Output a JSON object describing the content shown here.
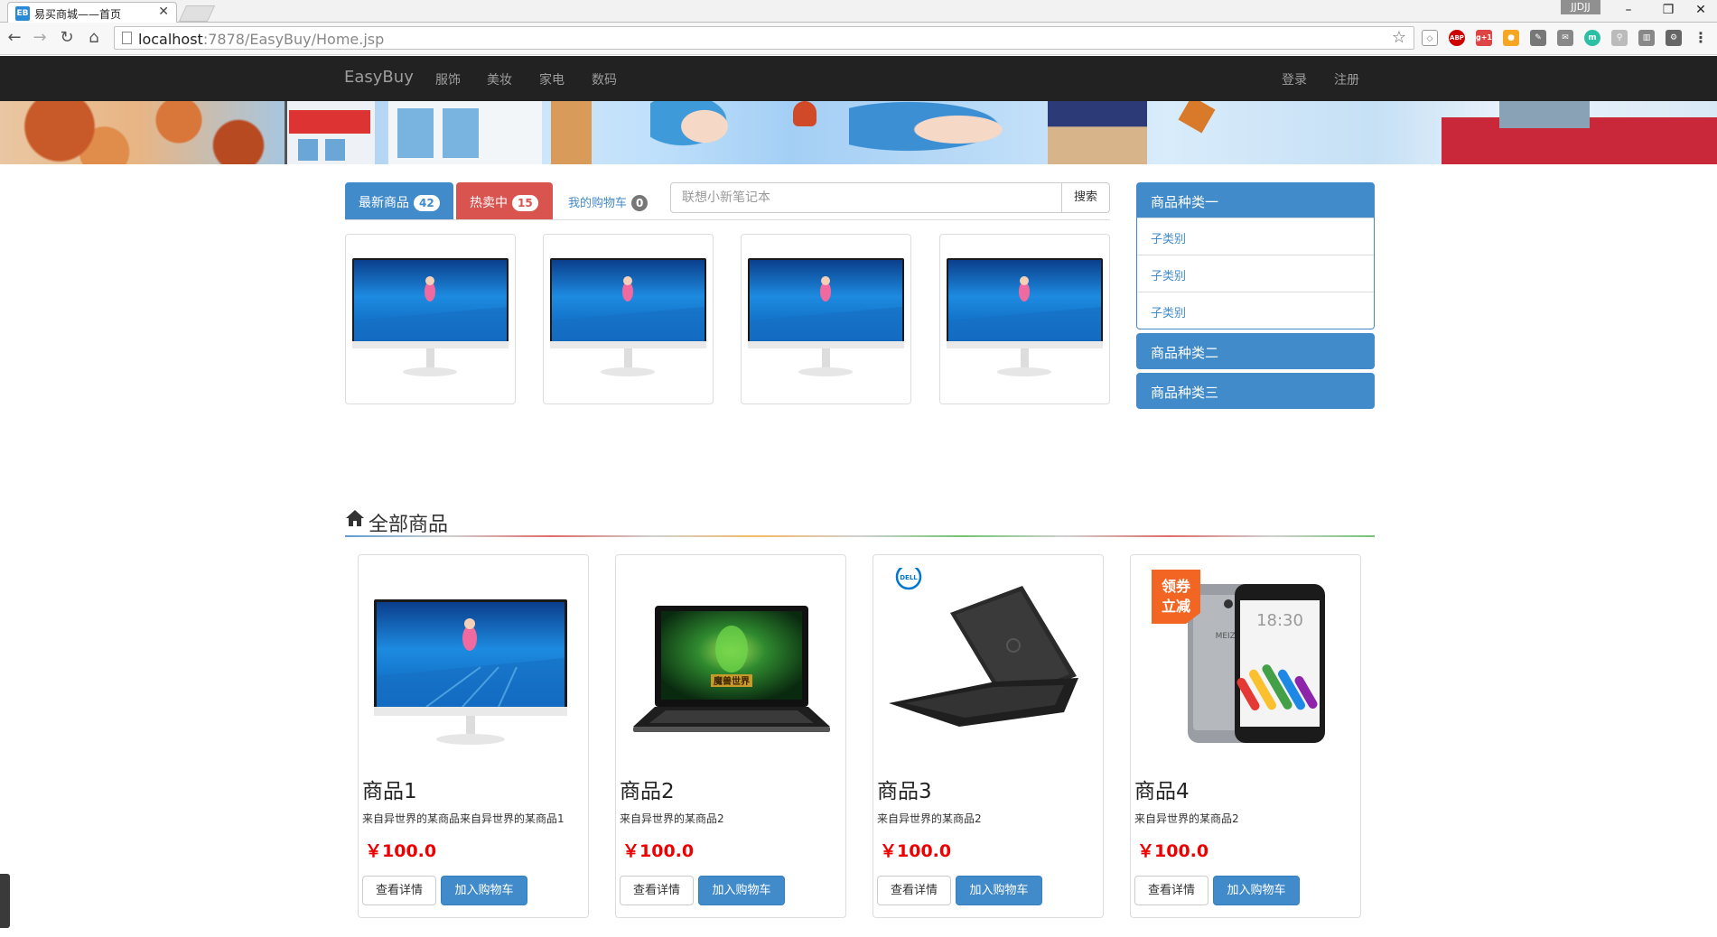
{
  "browser": {
    "tab_title": "易买商城——首页",
    "tab_favicon_text": "EB",
    "window_badge": "JJDJJ",
    "url_host": "localhost",
    "url_rest": ":7878/EasyBuy/Home.jsp"
  },
  "navbar": {
    "brand": "EasyBuy",
    "links": [
      "服饰",
      "美妆",
      "家电",
      "数码"
    ],
    "login": "登录",
    "register": "注册"
  },
  "tabs": {
    "newest": {
      "label": "最新商品",
      "count": "42"
    },
    "hot": {
      "label": "热卖中",
      "count": "15"
    },
    "cart": {
      "label": "我的购物车",
      "count": "0"
    }
  },
  "search": {
    "placeholder": "联想小新笔记本",
    "button": "搜索"
  },
  "categories": [
    {
      "title": "商品种类一",
      "items": [
        "子类别",
        "子类别",
        "子类别"
      ]
    },
    {
      "title": "商品种类二"
    },
    {
      "title": "商品种类三"
    }
  ],
  "all_products": {
    "title": "全部商品",
    "detail_button": "查看详情",
    "cart_button": "加入购物车",
    "items": [
      {
        "name": "商品1",
        "desc": "来自异世界的某商品来自异世界的某商品1",
        "price": "￥100.0",
        "image": "monitor"
      },
      {
        "name": "商品2",
        "desc": "来自异世界的某商品2",
        "price": "￥100.0",
        "image": "laptop"
      },
      {
        "name": "商品3",
        "desc": "来自异世界的某商品2",
        "price": "￥100.0",
        "image": "laptop-dell"
      },
      {
        "name": "商品4",
        "desc": "来自异世界的某商品2",
        "price": "￥100.0",
        "image": "phone"
      }
    ]
  },
  "product_images": {
    "laptop_screen_text": "魔兽世界",
    "dell_logo_text": "DELL",
    "phone_promo_text": [
      "领券",
      "立减"
    ],
    "phone_clock_text": "18:30",
    "phone_brand_text": "MEIZU"
  },
  "colors": {
    "primary": "#428bca",
    "danger": "#d9534f",
    "price": "#e00000",
    "navbar": "#222222"
  }
}
